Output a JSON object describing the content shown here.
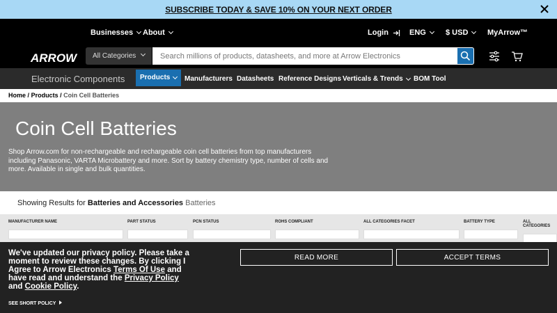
{
  "promo": {
    "text": "SUBSCRIBE TODAY & SAVE 10% ON YOUR NEXT ORDER"
  },
  "topnav": {
    "businesses": "Businesses",
    "about": "About",
    "login": "Login",
    "language": "ENG",
    "currency": "$ USD",
    "myarrow": "MyArrow™"
  },
  "header": {
    "logo": "ARROW",
    "category_select": "All Categories",
    "search_placeholder": "Search millions of products, datasheets, and more at Arrow Electronics"
  },
  "subnav": {
    "brand": "Electronic Components",
    "items": [
      {
        "label": "Products"
      },
      {
        "label": "Manufacturers"
      },
      {
        "label": "Datasheets"
      },
      {
        "label": "Reference Designs"
      },
      {
        "label": "Verticals & Trends"
      },
      {
        "label": "BOM Tool"
      }
    ]
  },
  "breadcrumb": {
    "home": "Home",
    "sep1": "/",
    "products": "Products",
    "sep2": "/",
    "current": "Coin Cell Batteries"
  },
  "hero": {
    "title": "Coin Cell Batteries",
    "description": "Shop Arrow.com for non-rechargeable and rechargeable coin cell batteries from top manufacturers including Panasonic, VARTA Microbattery and more. Sort by battery chemistry type, number of cells and more. Available in single and bulk quantities."
  },
  "results": {
    "prefix": "Showing Results for",
    "category": "Batteries and Accessories",
    "subcategory": "Batteries"
  },
  "filters": [
    {
      "label": "MANUFACTURER NAME"
    },
    {
      "label": "PART STATUS"
    },
    {
      "label": "PCN STATUS"
    },
    {
      "label": "ROHS COMPLIANT"
    },
    {
      "label": "ALL CATEGORIES FACET"
    },
    {
      "label": "BATTERY TYPE"
    },
    {
      "label": "ALL CATEGORIES"
    }
  ],
  "cookie": {
    "line1": "We've updated our privacy policy. Please take a moment to review these changes. By clicking I Agree to Arrow Electronics",
    "terms": "Terms Of Use",
    "line2": "and have read and understand the",
    "privacy": "Privacy Policy",
    "and": "and",
    "cookie_policy": "Cookie Policy",
    "end": ".",
    "read_more": "READ MORE",
    "accept": "ACCEPT TERMS",
    "short_policy": "SEE SHORT POLICY"
  },
  "colors": {
    "promo_bg": "#a8d8f5",
    "accent": "#1a6fb0",
    "hero_bg": "#7f7f7f"
  }
}
